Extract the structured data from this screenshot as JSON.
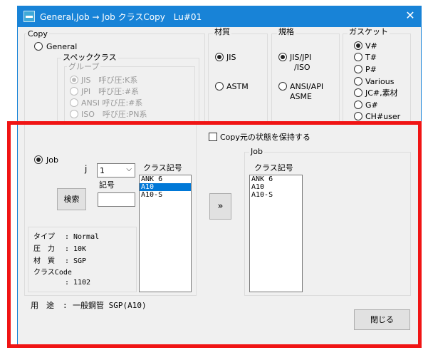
{
  "window": {
    "title": "General,Job → Job クラスCopy　Lu#01",
    "close_glyph": "✕"
  },
  "copy_group": {
    "label": "Copy",
    "general_label": "General",
    "general_selected": false,
    "spec_class": {
      "label": "スペッククラス",
      "group": {
        "label": "グループ",
        "options": [
          {
            "label": "JIS　呼び圧:K系",
            "selected": true
          },
          {
            "label": "JPI　呼び圧:#系",
            "selected": false
          },
          {
            "label": "ANSI 呼び圧:#系",
            "selected": false
          },
          {
            "label": "ISO　呼び圧:PN系",
            "selected": false
          }
        ]
      }
    }
  },
  "material_group": {
    "label": "材質",
    "options": [
      {
        "label": "JIS",
        "selected": true
      },
      {
        "label": "ASTM",
        "selected": false
      }
    ]
  },
  "standard_group": {
    "label": "規格",
    "options": [
      {
        "line1": "JIS/JPI",
        "line2": "/ISO",
        "selected": true
      },
      {
        "line1": "ANSI/API",
        "line2": "ASME",
        "selected": false
      }
    ]
  },
  "gasket_group": {
    "label": "ガスケット",
    "options": [
      {
        "label": "V#",
        "selected": true
      },
      {
        "label": "T#",
        "selected": false
      },
      {
        "label": "P#",
        "selected": false
      },
      {
        "label": "Various",
        "selected": false
      },
      {
        "label": "JC#,素材",
        "selected": false
      },
      {
        "label": "G#",
        "selected": false
      },
      {
        "label": "CH#user",
        "selected": false
      }
    ]
  },
  "keep_state": {
    "label": "Copy元の状態を保持する",
    "checked": false
  },
  "job_source": {
    "radio_label": "Job",
    "radio_selected": true,
    "j_label": "j",
    "j_value": "1",
    "code_label": "記号",
    "code_value": "",
    "search_button": "検索",
    "class_list_label": "クラス記号",
    "class_list": [
      {
        "label": "ANK 6",
        "selected": false
      },
      {
        "label": "A10",
        "selected": true
      },
      {
        "label": "A10-S",
        "selected": false
      }
    ],
    "info": {
      "type_label": "タイプ",
      "type_value": "Normal",
      "pressure_label": "圧　力",
      "pressure_value": "10K",
      "material_label": "材　質",
      "material_value": "SGP",
      "classcode_label": "クラスCode",
      "classcode_value": "1102"
    }
  },
  "transfer_button": "»",
  "job_target": {
    "label": "Job",
    "class_list_label": "クラス記号",
    "class_list": [
      "ANK 6",
      "A10",
      "A10-S"
    ]
  },
  "usage": {
    "label": "用　途",
    "value": "一般鋼管 SGP(A10)"
  },
  "close_button": "閉じる",
  "colors": {
    "titlebar": "#1883d7",
    "selection": "#0078d7",
    "highlight_frame": "#f01414"
  }
}
